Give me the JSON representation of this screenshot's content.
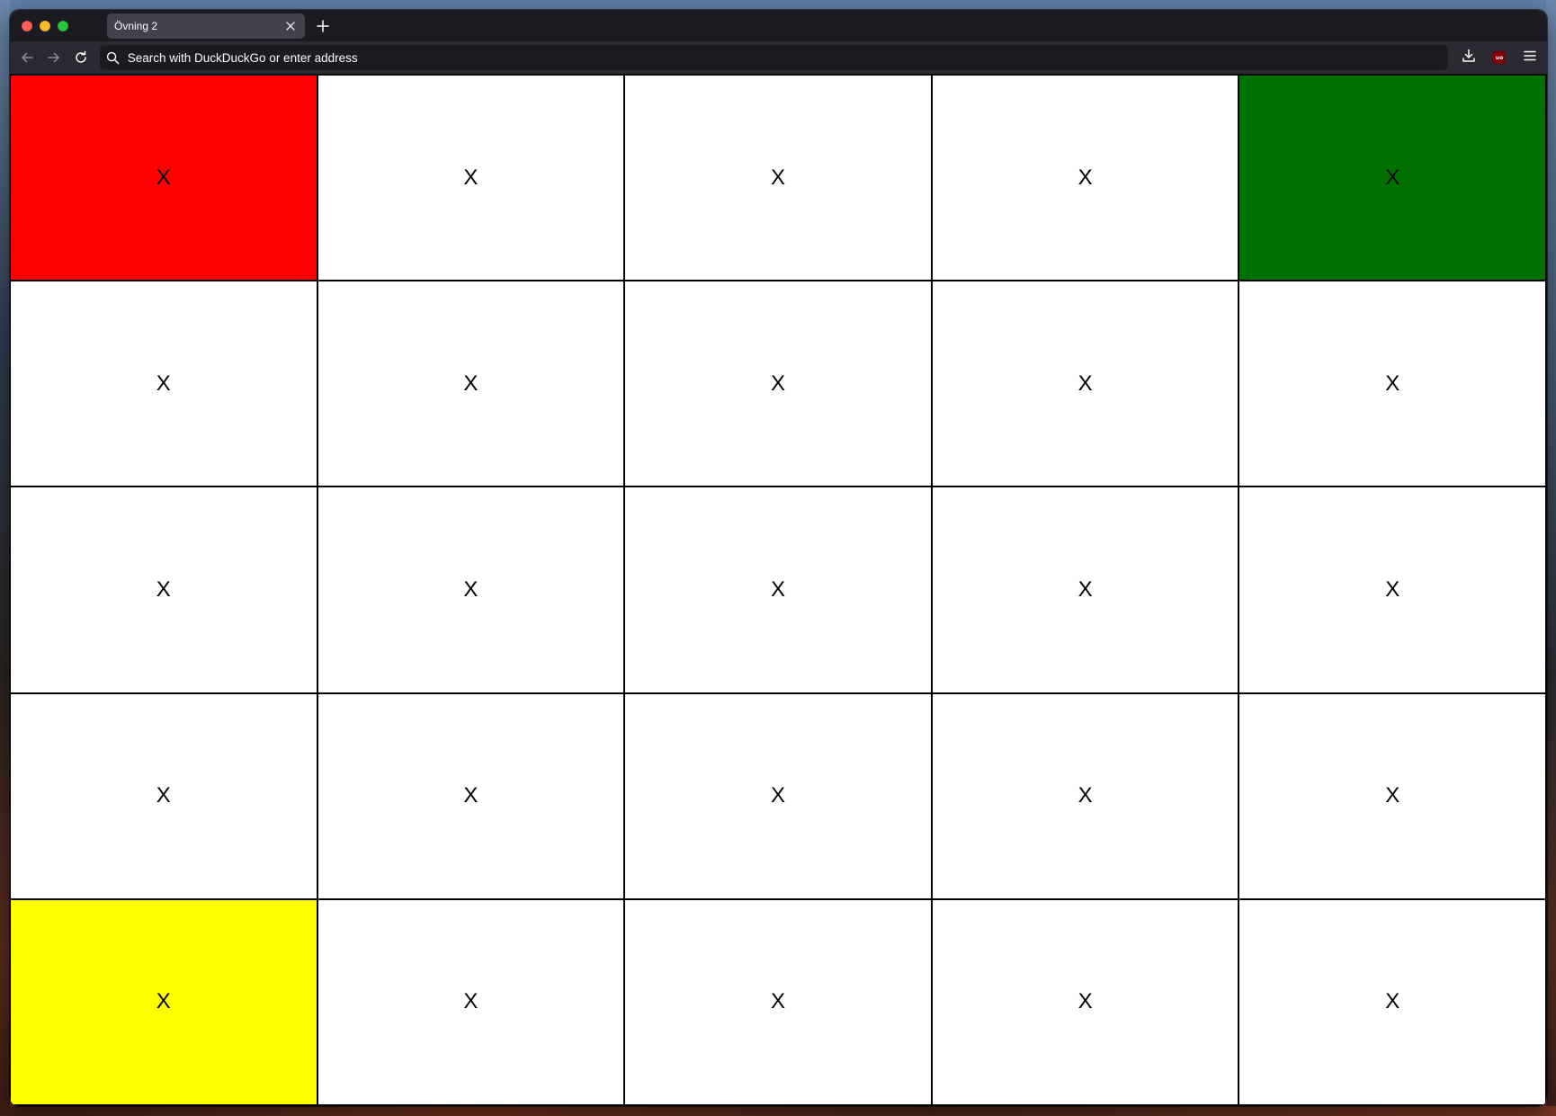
{
  "browser": {
    "tab_title": "Övning 2",
    "tab_close_icon": "close-icon",
    "new_tab_icon": "plus-icon",
    "address_placeholder": "Search with DuckDuckGo or enter address",
    "address_value": "",
    "ublock_label": "uo"
  },
  "colors": {
    "red": "#ff0000",
    "green": "#007000",
    "yellow": "#ffff00",
    "white": "#ffffff"
  },
  "grid": {
    "rows": [
      [
        {
          "text": "X",
          "color": "#ff0000"
        },
        {
          "text": "X",
          "color": "#ffffff"
        },
        {
          "text": "X",
          "color": "#ffffff"
        },
        {
          "text": "X",
          "color": "#ffffff"
        },
        {
          "text": "X",
          "color": "#007000"
        }
      ],
      [
        {
          "text": "X",
          "color": "#ffffff"
        },
        {
          "text": "X",
          "color": "#ffffff"
        },
        {
          "text": "X",
          "color": "#ffffff"
        },
        {
          "text": "X",
          "color": "#ffffff"
        },
        {
          "text": "X",
          "color": "#ffffff"
        }
      ],
      [
        {
          "text": "X",
          "color": "#ffffff"
        },
        {
          "text": "X",
          "color": "#ffffff"
        },
        {
          "text": "X",
          "color": "#ffffff"
        },
        {
          "text": "X",
          "color": "#ffffff"
        },
        {
          "text": "X",
          "color": "#ffffff"
        }
      ],
      [
        {
          "text": "X",
          "color": "#ffffff"
        },
        {
          "text": "X",
          "color": "#ffffff"
        },
        {
          "text": "X",
          "color": "#ffffff"
        },
        {
          "text": "X",
          "color": "#ffffff"
        },
        {
          "text": "X",
          "color": "#ffffff"
        }
      ],
      [
        {
          "text": "X",
          "color": "#ffff00"
        },
        {
          "text": "X",
          "color": "#ffffff"
        },
        {
          "text": "X",
          "color": "#ffffff"
        },
        {
          "text": "X",
          "color": "#ffffff"
        },
        {
          "text": "X",
          "color": "#ffffff"
        }
      ]
    ]
  }
}
